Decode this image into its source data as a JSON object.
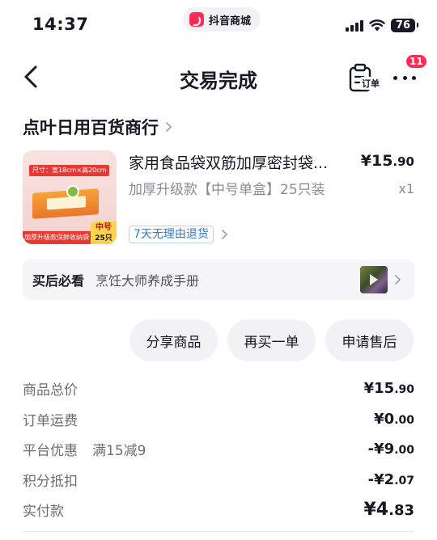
{
  "status_bar": {
    "time": "14:37",
    "app_name": "抖音商城",
    "battery": "76"
  },
  "nav": {
    "title": "交易完成",
    "order_label": "订单",
    "badge_count": "11"
  },
  "shop": {
    "name": "点叶日用百货商行"
  },
  "product": {
    "title": "家用食品袋双筋加厚密封袋...",
    "price_int": "¥15",
    "price_dec": ".90",
    "variant": "加厚升级款【中号单盒】25只装",
    "quantity": "x1",
    "return_policy": "7天无理由退货",
    "thumb": {
      "top_banner": "尺寸：宽18cm×高20cm",
      "bottom_banner": "加厚升级款保鲜收纳袋",
      "tag_size": "中号",
      "tag_count": "25只"
    }
  },
  "guide": {
    "label": "买后必看",
    "text": "烹饪大师养成手册"
  },
  "actions": {
    "share": "分享商品",
    "rebuy": "再买一单",
    "after_sale": "申请售后"
  },
  "summary": {
    "goods_total": {
      "label": "商品总价",
      "int": "¥15",
      "dec": ".90"
    },
    "shipping": {
      "label": "订单运费",
      "int": "¥0",
      "dec": ".00"
    },
    "platform_discount": {
      "label": "平台优惠",
      "note": "满15减9",
      "int": "-¥9",
      "dec": ".00"
    },
    "points_deduct": {
      "label": "积分抵扣",
      "int": "-¥2",
      "dec": ".07"
    },
    "paid": {
      "label": "实付款",
      "int": "¥4",
      "dec": ".83"
    }
  }
}
